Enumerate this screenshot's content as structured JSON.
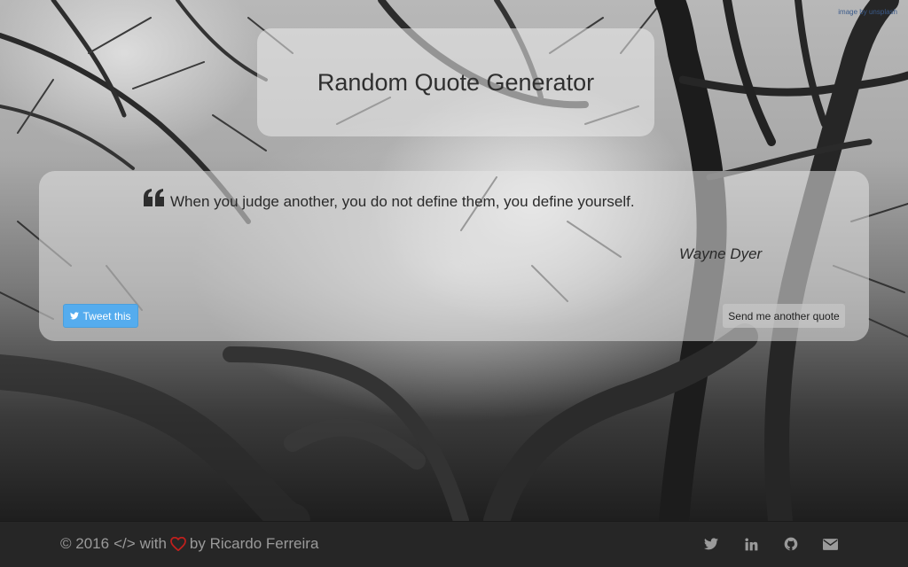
{
  "credit": "image by unsplash",
  "header": {
    "title": "Random Quote Generator"
  },
  "quote": {
    "icon": "quote-left-icon",
    "text": "When you judge another, you do not define them, you define yourself.",
    "author": "Wayne Dyer"
  },
  "buttons": {
    "tweet_label": "Tweet this",
    "tweet_icon": "twitter-icon",
    "next_label": "Send me another quote"
  },
  "footer": {
    "copyright": "© 2016",
    "code_symbol": "</>",
    "with": "with",
    "heart_icon": "heart-icon",
    "by": "by Ricardo Ferreira",
    "social": [
      "twitter-icon",
      "linkedin-icon",
      "github-icon",
      "envelope-icon"
    ]
  },
  "colors": {
    "twitter_blue": "#55acee",
    "heart_red": "#c0201d",
    "footer_bg": "#262626"
  }
}
